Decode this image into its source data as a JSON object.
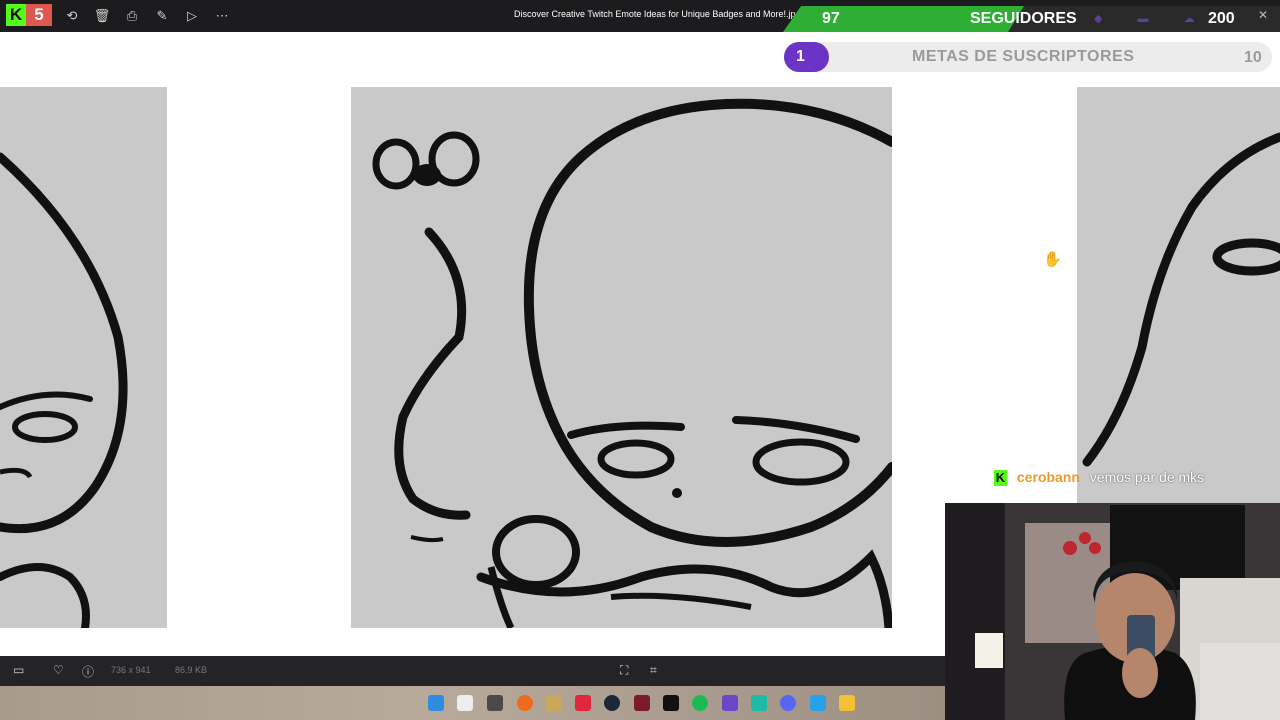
{
  "top_bar": {
    "window_title": "Discover Creative Twitch Emote Ideas for Unique Badges and More!.jpg",
    "logo_letter": "K",
    "logo_number": "5",
    "icons": [
      "rotate-icon",
      "trash-icon",
      "print-icon",
      "edit-icon",
      "slideshow-icon",
      "more-icon"
    ]
  },
  "followers_goal": {
    "current": "97",
    "label": "SEGUIDORES",
    "target": "200",
    "progress": 0.485,
    "color": "#2fae35"
  },
  "subscriber_goal": {
    "current": "1",
    "label": "METAS DE SUSCRIPTORES",
    "target": "10",
    "color": "#6b33c6"
  },
  "chat": {
    "platform_badge": "K",
    "username": "cerobann",
    "message": "vemos par de mks",
    "username_color": "#e89a2c"
  },
  "image_info": {
    "dimensions": "736 x 941",
    "file_size": "86.9 KB"
  },
  "bottom_bar": {
    "icons": [
      "display-icon",
      "heart-icon",
      "info-icon",
      "fit-screen-icon",
      "crop-icon"
    ]
  },
  "taskbar": {
    "apps": [
      "windows-start-icon",
      "gallery-icon",
      "calendar-icon",
      "browser-icon",
      "folder-icon",
      "flash-icon",
      "steam-icon",
      "video-app-icon",
      "tiktok-icon",
      "spotify-icon",
      "twitch-icon",
      "game-app-icon",
      "discord-icon",
      "studio-icon",
      "file-explorer-icon"
    ]
  }
}
